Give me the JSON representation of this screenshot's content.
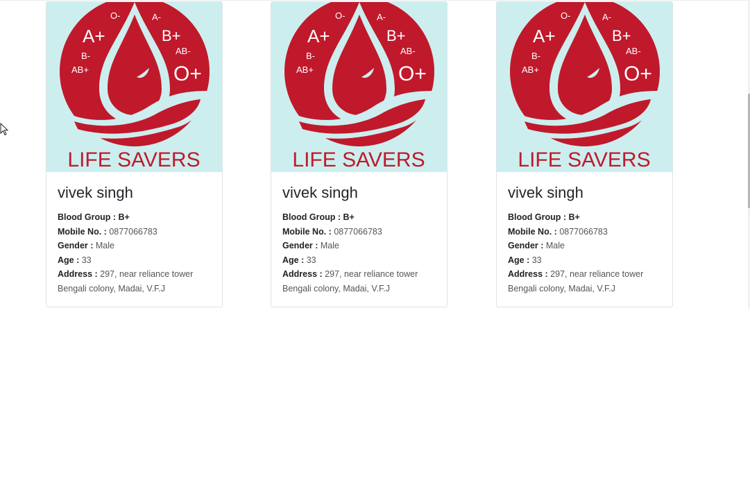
{
  "donors": [
    {
      "name": "vivek singh",
      "blood_group_label": "Blood Group :",
      "blood_group": "B+",
      "mobile_label": "Mobile No. :",
      "mobile": "0877066783",
      "gender_label": "Gender :",
      "gender": "Male",
      "age_label": "Age :",
      "age": "33",
      "address_label": "Address :",
      "address_line1": "297, near reliance tower",
      "address_line2": "Bengali colony, Madai, V.F.J"
    },
    {
      "name": "vivek singh",
      "blood_group_label": "Blood Group :",
      "blood_group": "B+",
      "mobile_label": "Mobile No. :",
      "mobile": "0877066783",
      "gender_label": "Gender :",
      "gender": "Male",
      "age_label": "Age :",
      "age": "33",
      "address_label": "Address :",
      "address_line1": "297, near reliance tower",
      "address_line2": "Bengali colony, Madai, V.F.J"
    },
    {
      "name": "vivek singh",
      "blood_group_label": "Blood Group :",
      "blood_group": "B+",
      "mobile_label": "Mobile No. :",
      "mobile": "0877066783",
      "gender_label": "Gender :",
      "gender": "Male",
      "age_label": "Age :",
      "age": "33",
      "address_label": "Address :",
      "address_line1": "297, near reliance tower",
      "address_line2": "Bengali colony, Madai, V.F.J"
    }
  ],
  "logo": {
    "groups": [
      "A+",
      "O-",
      "A-",
      "B+",
      "AB-",
      "B-",
      "AB+",
      "O+"
    ],
    "caption": "LIFE SAVERS",
    "colors": {
      "red": "#c0192c",
      "background": "#cdeeee"
    }
  },
  "icons": {
    "cursor": "mouse-pointer-icon",
    "logo": "blood-drop-hand-icon"
  }
}
